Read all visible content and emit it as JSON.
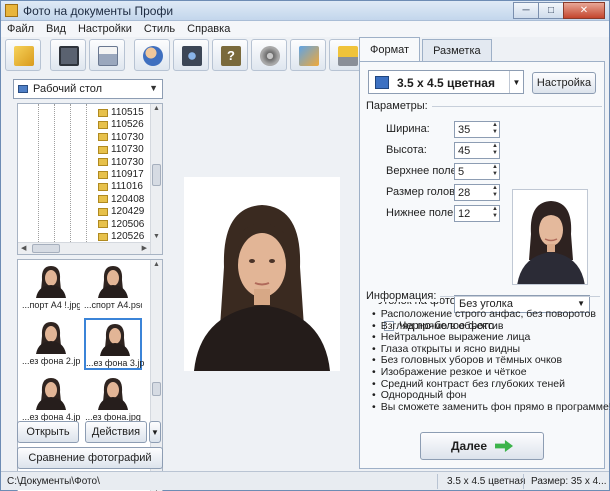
{
  "window": {
    "title": "Фото на документы Профи"
  },
  "menu": [
    "Файл",
    "Вид",
    "Настройки",
    "Стиль",
    "Справка"
  ],
  "toolbar": {
    "icons": [
      "wizard-icon",
      "save-icon",
      "print-icon",
      "users-icon",
      "camera-icon",
      "help-icon",
      "video-icon",
      "share-icon",
      "cart-icon"
    ]
  },
  "left": {
    "location": "Рабочий стол",
    "folders": [
      "110515",
      "110526",
      "110730",
      "110730",
      "110730",
      "110917",
      "111016",
      "120408",
      "120429",
      "120506",
      "120526"
    ],
    "thumbnails": [
      {
        "label": "...порт А4 !.jpg",
        "selected": false
      },
      {
        "label": "...спорт А4.psd",
        "selected": false
      },
      {
        "label": "...ез фона 2.jpg",
        "selected": false
      },
      {
        "label": "...ез фона 3.jpg",
        "selected": true
      },
      {
        "label": "...ез фона 4.jpg",
        "selected": false
      },
      {
        "label": "...ез фона.jpg",
        "selected": false
      }
    ],
    "open_label": "Открыть",
    "actions_label": "Действия",
    "compare_label": "Сравнение фотографий"
  },
  "right": {
    "tabs": [
      "Формат",
      "Разметка"
    ],
    "format": "3.5 х 4.5 цветная",
    "config_label": "Настройка",
    "params_title": "Параметры:",
    "params": [
      {
        "label": "Ширина:",
        "value": "35"
      },
      {
        "label": "Высота:",
        "value": "45"
      },
      {
        "label": "Верхнее поле:",
        "value": "5"
      },
      {
        "label": "Размер головы:",
        "value": "28"
      },
      {
        "label": "Нижнее поле:",
        "value": "12"
      }
    ],
    "corner_label": "Уголок на фото:",
    "corner_value": "Без уголка",
    "bw_label": "Черно-белое фото",
    "info_title": "Информация:",
    "info": [
      "Расположение строго анфас, без поворотов",
      "Взгляд прямо в объектив",
      "Нейтральное выражение лица",
      "Глаза открыты и ясно видны",
      "Без головных уборов и тёмных очков",
      "Изображение резкое и чёткое",
      "Средний контраст без глубоких теней",
      "Однородный фон",
      "Вы сможете заменить фон прямо в программе!"
    ],
    "next_label": "Далее"
  },
  "status": {
    "path": "C:\\Документы\\Фото\\",
    "format": "3.5 х 4.5 цветная",
    "size": "Размер: 35 х 4..."
  },
  "colors": {
    "accent": "#3b84d8",
    "title_gradient_top": "#dfeaf6",
    "next_arrow": "#3bb34a"
  }
}
